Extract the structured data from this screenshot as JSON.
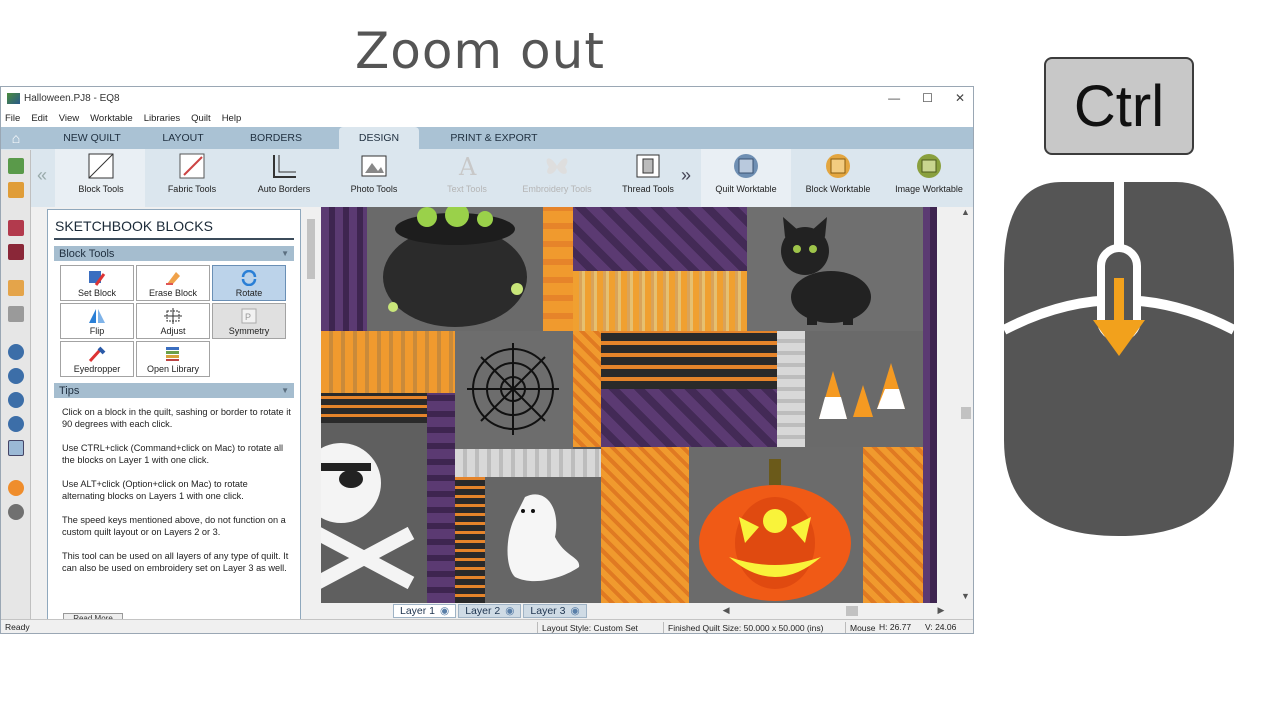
{
  "overlay": {
    "heading": "Zoom out",
    "key_label": "Ctrl"
  },
  "window": {
    "title": "Halloween.PJ8 - EQ8"
  },
  "menu": [
    "File",
    "Edit",
    "View",
    "Worktable",
    "Libraries",
    "Quilt",
    "Help"
  ],
  "tabs": [
    "NEW QUILT",
    "LAYOUT",
    "BORDERS",
    "DESIGN",
    "PRINT & EXPORT"
  ],
  "active_tab": "DESIGN",
  "ribbon": {
    "block_tools": "Block Tools",
    "fabric_tools": "Fabric Tools",
    "auto_borders": "Auto Borders",
    "photo_tools": "Photo Tools",
    "text_tools": "Text Tools",
    "embroidery_tools": "Embroidery Tools",
    "thread_tools": "Thread Tools",
    "quilt_worktable": "Quilt Worktable",
    "block_worktable": "Block Worktable",
    "image_worktable": "Image Worktable"
  },
  "panel": {
    "title": "SKETCHBOOK BLOCKS",
    "section_tools": "Block Tools",
    "tools": {
      "set_block": "Set Block",
      "erase_block": "Erase Block",
      "rotate": "Rotate",
      "flip": "Flip",
      "adjust": "Adjust",
      "symmetry": "Symmetry",
      "eyedropper": "Eyedropper",
      "open_library": "Open Library"
    },
    "section_tips": "Tips",
    "tips": [
      "Click on a block in the quilt, sashing or border to rotate it 90 degrees with each click.",
      "Use CTRL+click (Command+click on Mac) to rotate all the blocks on Layer 1 with one click.",
      "Use ALT+click (Option+click on Mac) to rotate alternating blocks on Layers 1 with one click.",
      "The speed keys mentioned above, do not function on a custom quilt layout or on Layers 2 or 3.",
      "This tool can be used on all layers of any type of quilt. It can also be used on embroidery set on Layer 3 as well."
    ],
    "read_more": "Read More"
  },
  "layers": [
    "Layer 1",
    "Layer 2",
    "Layer 3"
  ],
  "status": {
    "ready": "Ready",
    "layout_style": "Layout Style: Custom Set",
    "finished_size": "Finished Quilt Size: 50.000 x 50.000 (ins)",
    "mouse_label": "Mouse",
    "mouse_h": "H: 26.77",
    "mouse_v": "V: 24.06"
  },
  "colors": {
    "accent_orange": "#f09a2e",
    "purple": "#5b3a72",
    "mouse_body": "#555555",
    "scroll_arrow": "#f2a11c"
  }
}
